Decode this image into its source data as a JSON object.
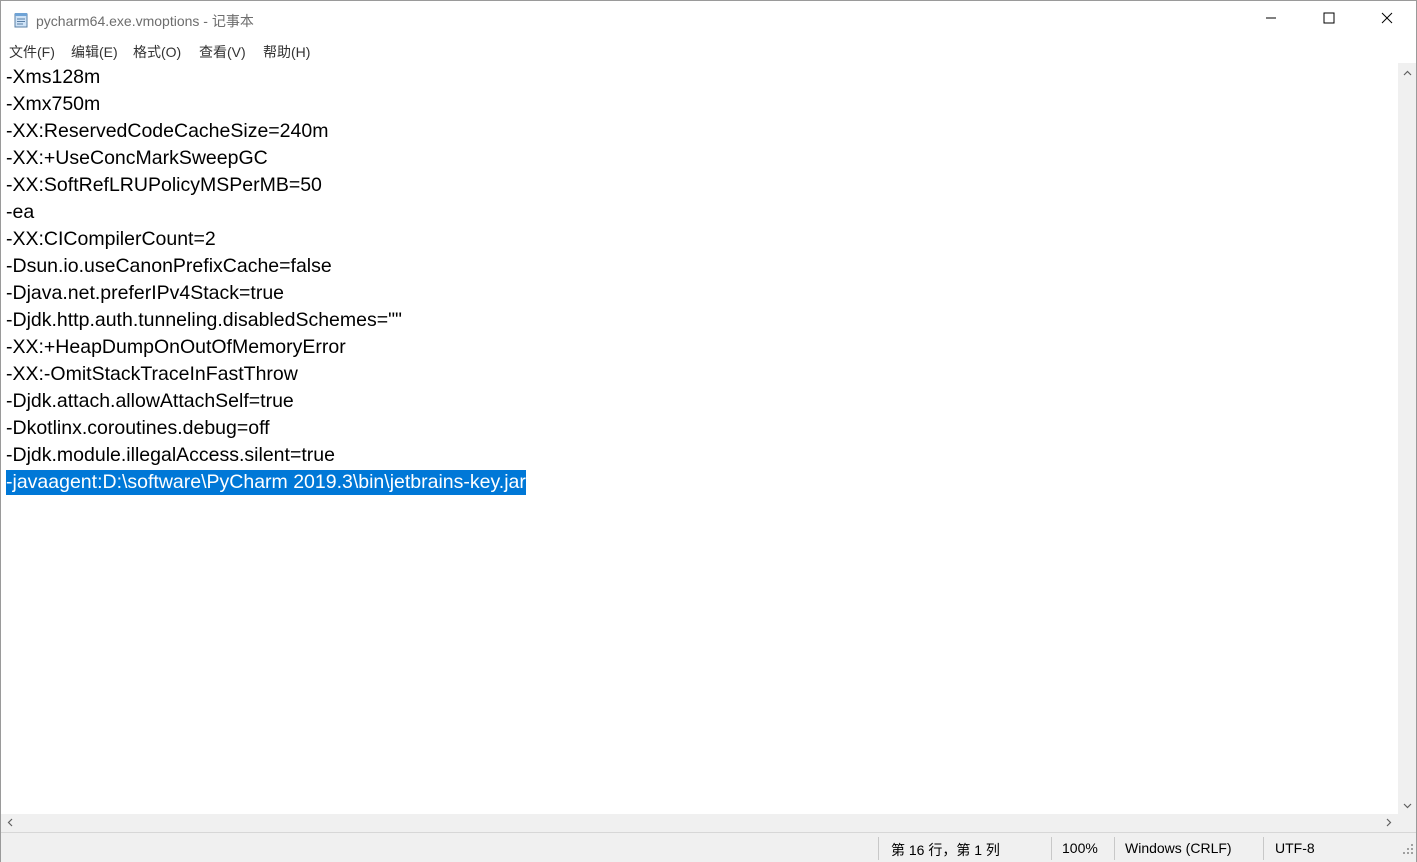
{
  "window": {
    "title": "pycharm64.exe.vmoptions - 记事本",
    "icon": "notepad-icon",
    "controls": [
      "minimize-icon",
      "maximize-icon",
      "close-icon"
    ]
  },
  "menu": {
    "items": [
      "文件(F)",
      "编辑(E)",
      "格式(O)",
      "查看(V)",
      "帮助(H)"
    ]
  },
  "editor": {
    "lines": [
      "-Xms128m",
      "-Xmx750m",
      "-XX:ReservedCodeCacheSize=240m",
      "-XX:+UseConcMarkSweepGC",
      "-XX:SoftRefLRUPolicyMSPerMB=50",
      "-ea",
      "-XX:CICompilerCount=2",
      "-Dsun.io.useCanonPrefixCache=false",
      "-Djava.net.preferIPv4Stack=true",
      "-Djdk.http.auth.tunneling.disabledSchemes=\"\"",
      "-XX:+HeapDumpOnOutOfMemoryError",
      "-XX:-OmitStackTraceInFastThrow",
      "-Djdk.attach.allowAttachSelf=true",
      "-Dkotlinx.coroutines.debug=off",
      "-Djdk.module.illegalAccess.silent=true",
      "-javaagent:D:\\software\\PyCharm 2019.3\\bin\\jetbrains-key.jar"
    ],
    "selected_line_index": 15,
    "selection_color": "#0078d7"
  },
  "status": {
    "position": "第 16 行，第 1 列",
    "zoom": "100%",
    "line_ending": "Windows (CRLF)",
    "encoding": "UTF-8"
  }
}
